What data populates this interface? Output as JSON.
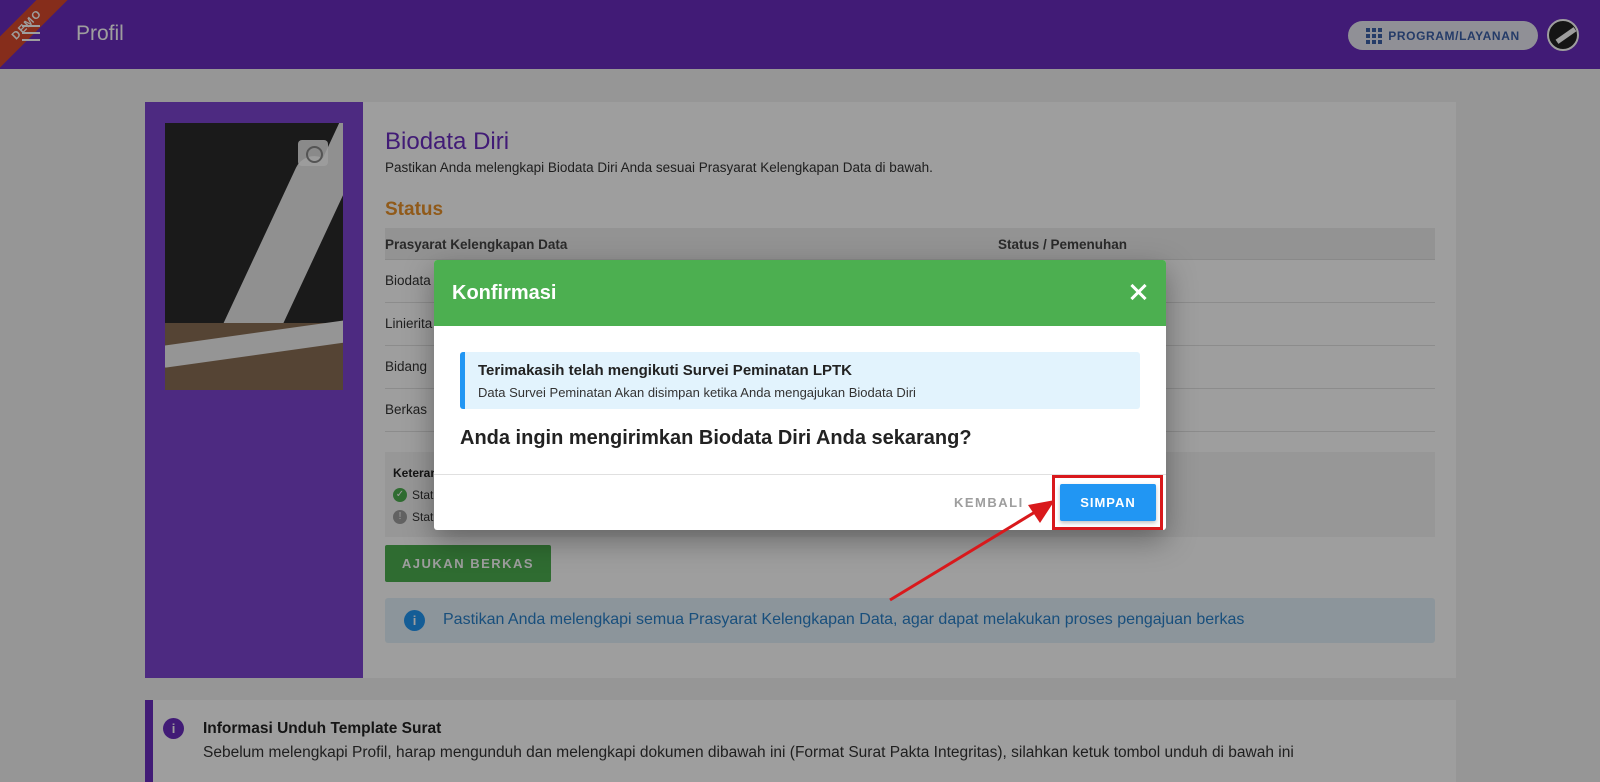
{
  "appbar": {
    "title": "Profil",
    "demo_label": "DEMO",
    "program_button": "PROGRAM/LAYANAN"
  },
  "biodata": {
    "title": "Biodata Diri",
    "subtitle": "Pastikan Anda melengkapi Biodata Diri Anda sesuai Prasyarat Kelengkapan Data di bawah.",
    "status_title": "Status",
    "table_headers": [
      "Prasyarat Kelengkapan Data",
      "Status / Pemenuhan"
    ],
    "rows": [
      "Biodata",
      "Linierita",
      "Bidang",
      "Berkas"
    ],
    "keterangan_title": "Keteran",
    "keterangan_items": [
      "Stat",
      "Stat"
    ],
    "submit_button": "AJUKAN BERKAS",
    "info_text": "Pastikan Anda melengkapi semua Prasyarat Kelengkapan Data, agar dapat melakukan proses pengajuan berkas"
  },
  "template_info": {
    "title": "Informasi Unduh Template Surat",
    "text": "Sebelum melengkapi Profil, harap mengunduh dan melengkapi dokumen dibawah ini (Format Surat Pakta Integritas), silahkan ketuk tombol unduh di bawah ini"
  },
  "dialog": {
    "title": "Konfirmasi",
    "alert_title": "Terimakasih telah mengikuti Survei Peminatan LPTK",
    "alert_text": "Data Survei Peminatan Akan disimpan ketika Anda mengajukan Biodata Diri",
    "question": "Anda ingin mengirimkan Biodata Diri Anda sekarang?",
    "cancel_label": "KEMBALI",
    "confirm_label": "SIMPAN"
  },
  "colors": {
    "appbar": "#6a2dbe",
    "dialog_header": "#4caf50",
    "primary_button": "#2196f3",
    "annotation": "#d9191c"
  }
}
